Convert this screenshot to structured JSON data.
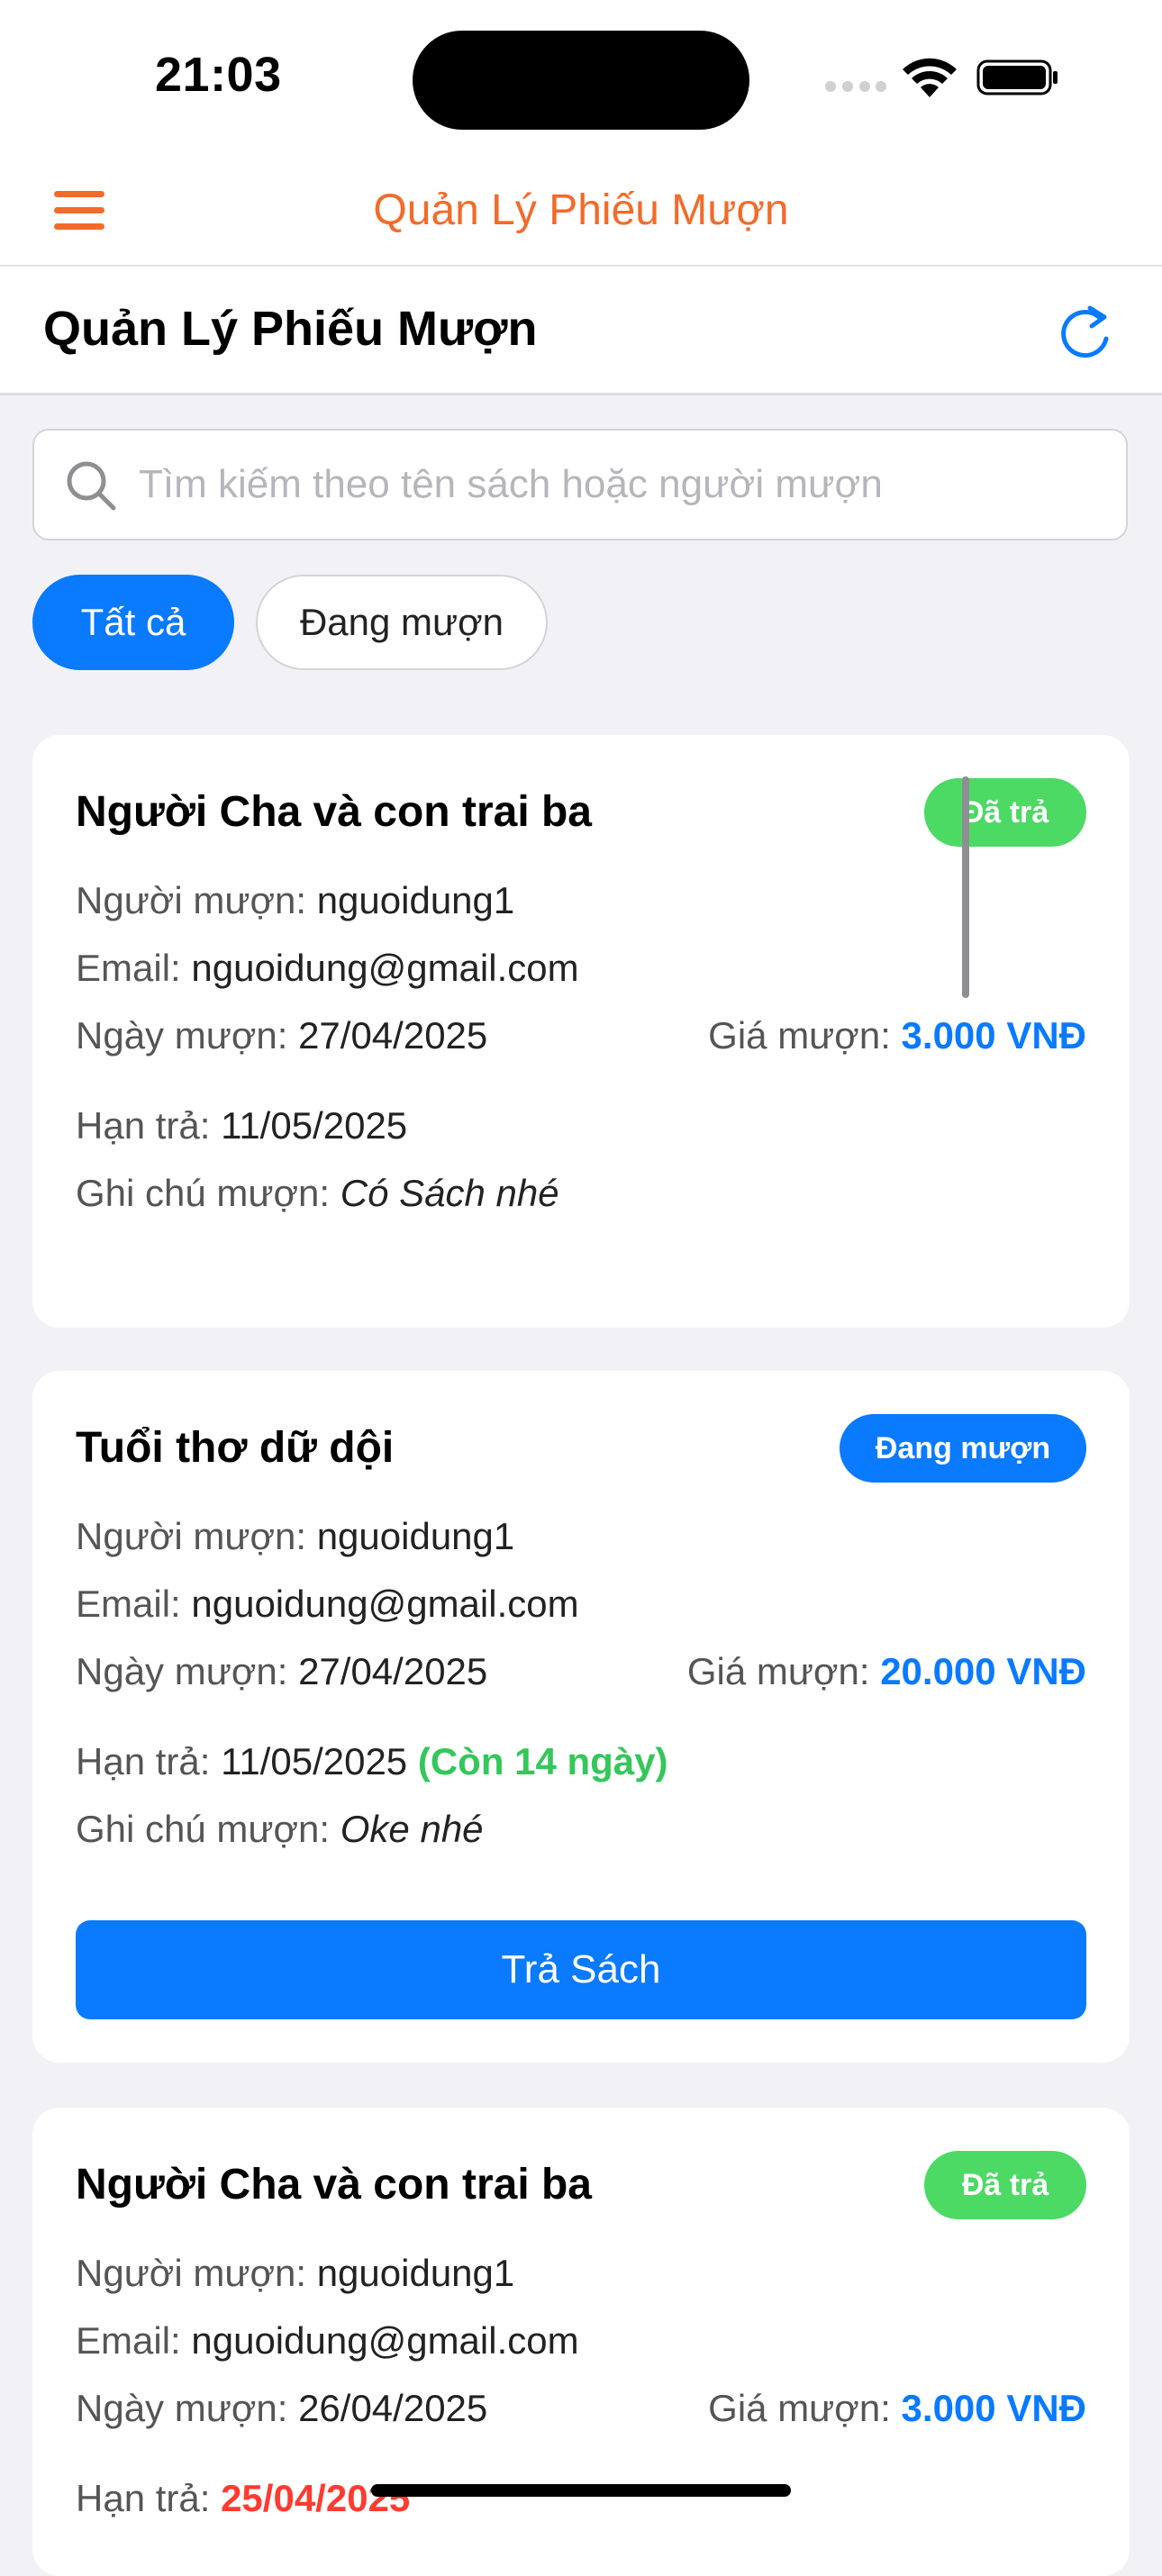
{
  "status_bar": {
    "time": "21:03"
  },
  "nav": {
    "title": "Quản Lý Phiếu Mượn",
    "menu_icon": "hamburger-icon"
  },
  "header": {
    "title": "Quản Lý Phiếu Mượn",
    "refresh_icon": "refresh-icon"
  },
  "search": {
    "placeholder": "Tìm kiếm theo tên sách hoặc người mượn",
    "value": ""
  },
  "filters": {
    "all": "Tất cả",
    "borrowing": "Đang mượn",
    "selected": "Tất cả"
  },
  "labels": {
    "borrower": "Người mượn:",
    "email": "Email:",
    "borrow_date": "Ngày mượn:",
    "price": "Giá mượn:",
    "due_date": "Hạn trả:",
    "note": "Ghi chú mượn:"
  },
  "colors": {
    "accent": "#0a7aff",
    "brand_orange": "#f26b2a",
    "returned_green": "#4cd964",
    "days_left_green": "#34c759",
    "overdue_red": "#ff3b30"
  },
  "loans": [
    {
      "title": "Người Cha và con trai ba",
      "status": "Đã trả",
      "borrower": "nguoidung1",
      "email": "nguoidung@gmail.com",
      "borrow_date": "27/04/2025",
      "price": "3.000 VNĐ",
      "due_date": "11/05/2025",
      "note": "Có Sách nhé"
    },
    {
      "title": "Tuổi thơ dữ dội",
      "status": "Đang mượn",
      "borrower": "nguoidung1",
      "email": "nguoidung@gmail.com",
      "borrow_date": "27/04/2025",
      "price": "20.000 VNĐ",
      "due_date": "11/05/2025",
      "days_left": "(Còn 14 ngày)",
      "note": "Oke nhé",
      "action": "Trả Sách"
    },
    {
      "title": "Người Cha và con trai ba",
      "status": "Đã trả",
      "borrower": "nguoidung1",
      "email": "nguoidung@gmail.com",
      "borrow_date": "26/04/2025",
      "price": "3.000 VNĐ",
      "due_date": "25/04/2025"
    }
  ]
}
